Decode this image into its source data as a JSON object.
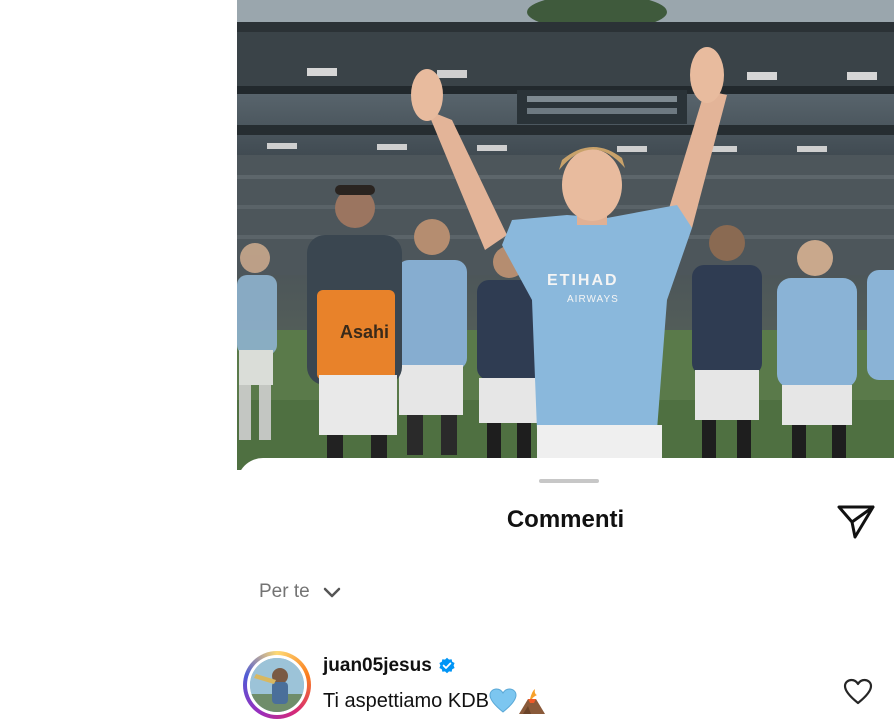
{
  "post": {
    "photo_alt": "",
    "jersey_sponsor": "ETIHAD AIRWAYS",
    "bib_sponsor": "Asahi"
  },
  "sheet": {
    "title": "Commenti",
    "send_icon": "paper-plane-icon"
  },
  "filter": {
    "label": "Per te",
    "icon": "chevron-down-icon"
  },
  "comments": [
    {
      "username": "juan05jesus",
      "verified": true,
      "verified_icon": "verified-badge-icon",
      "text": "Ti aspettiamo KDB",
      "emojis": [
        "light-blue-heart-emoji",
        "volcano-emoji"
      ],
      "like_icon": "heart-outline-icon"
    }
  ],
  "colors": {
    "verified_blue": "#0095f6",
    "text_primary": "#111111",
    "text_secondary": "#737373",
    "jersey_blue": "#8ab8dc",
    "bib_orange": "#e8822a"
  }
}
